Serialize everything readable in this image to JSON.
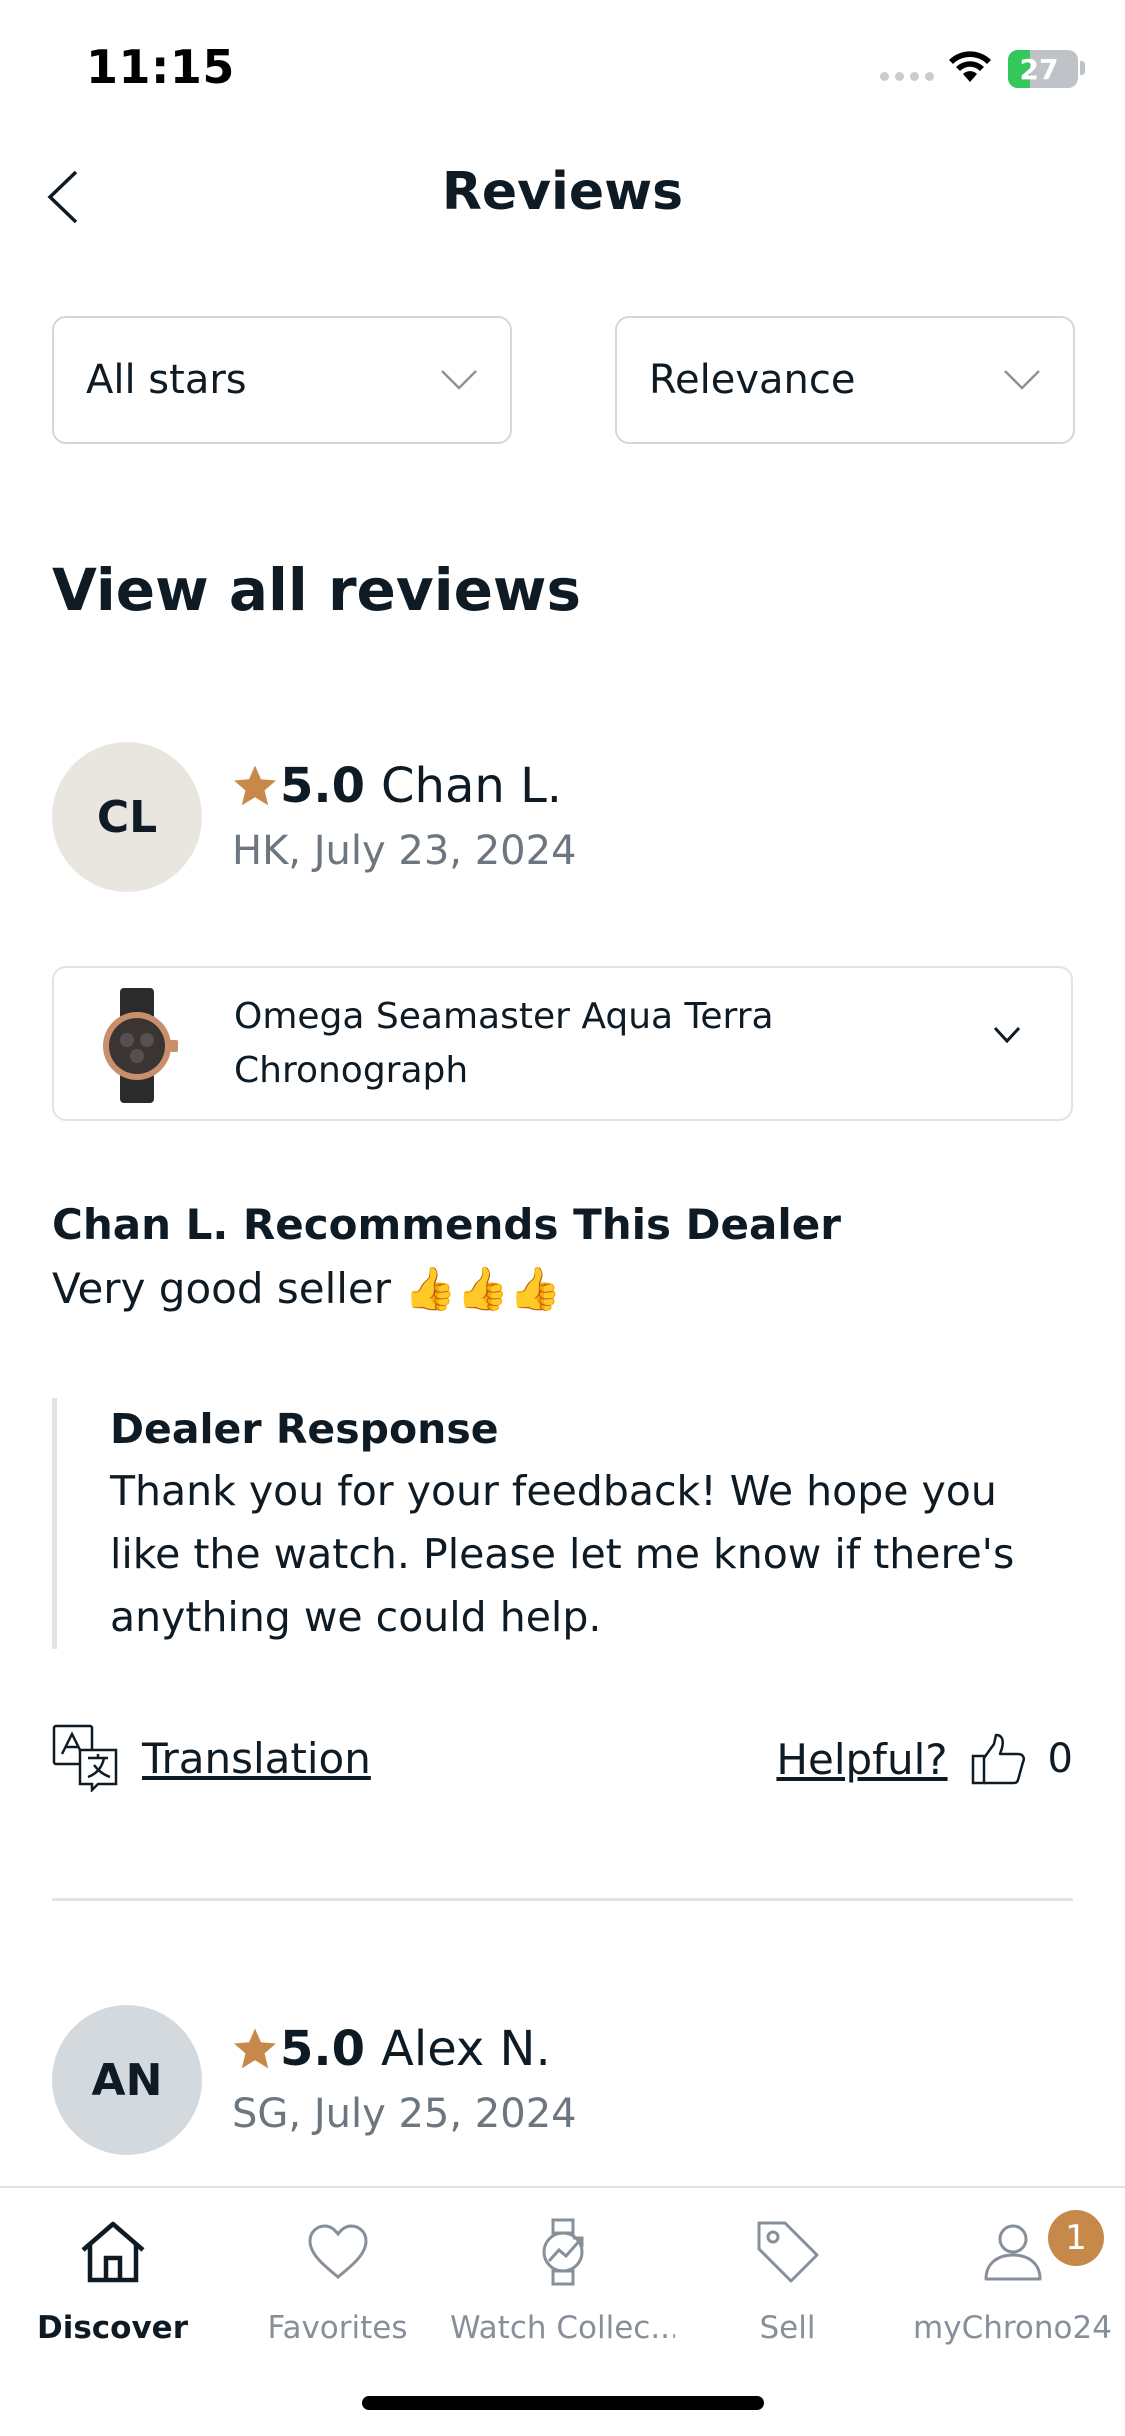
{
  "status_bar": {
    "time": "11:15",
    "battery": "27"
  },
  "header": {
    "title": "Reviews"
  },
  "filters": {
    "stars": "All stars",
    "sort": "Relevance"
  },
  "section": {
    "title": "View all reviews"
  },
  "reviews": [
    {
      "initials": "CL",
      "rating": "5.0",
      "name": "Chan L.",
      "meta": "HK, July 23, 2024",
      "product_line1": "Omega Seamaster Aqua Terra",
      "product_line2": "Chronograph",
      "recommendation": "Chan L. Recommends This Dealer",
      "text": "Very good seller 👍👍👍",
      "dealer_response_title": "Dealer Response",
      "dealer_response_text": "Thank you for your feedback! We hope you like the watch. Please let me know if there's anything we could help.",
      "translation_label": "Translation",
      "helpful_label": "Helpful?",
      "helpful_count": "0"
    },
    {
      "initials": "AN",
      "rating": "5.0",
      "name": "Alex N.",
      "meta": "SG, July 25, 2024"
    }
  ],
  "tabs": [
    {
      "label": "Discover",
      "icon": "home-icon",
      "active": true
    },
    {
      "label": "Favorites",
      "icon": "heart-icon",
      "active": false
    },
    {
      "label": "Watch Collec...",
      "icon": "watch-chart-icon",
      "active": false
    },
    {
      "label": "Sell",
      "icon": "tag-icon",
      "active": false
    },
    {
      "label": "myChrono24",
      "icon": "user-icon",
      "active": false,
      "badge": "1"
    }
  ],
  "colors": {
    "star": "#c7894a",
    "badge": "#c7894a",
    "text": "#0e1b24",
    "muted": "#6b7680"
  }
}
